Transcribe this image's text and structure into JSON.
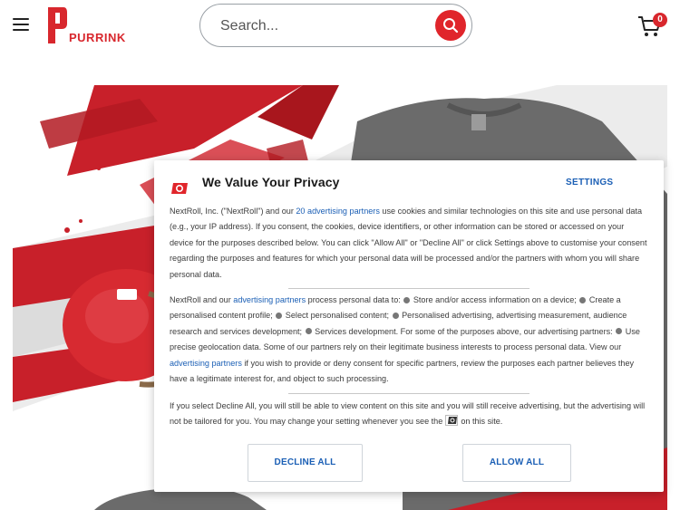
{
  "header": {
    "logo_text": "PURRINK",
    "search_placeholder": "Search...",
    "cart_count": "0"
  },
  "consent": {
    "title": "We Value Your Privacy",
    "settings_label": "SETTINGS",
    "p1_a": "NextRoll, Inc. (\"NextRoll\") and our ",
    "p1_link": "20 advertising partners",
    "p1_b": " use cookies and similar technologies on this site and use personal data (e.g., your IP address). If you consent, the cookies, device identifiers, or other information can be stored or accessed on your device for the purposes described below. You can click \"Allow All\" or \"Decline All\" or click Settings above to customise your consent regarding the purposes and features for which your personal data will be processed and/or the partners with whom you will share personal data.",
    "p2_a": "NextRoll and our ",
    "p2_link1": "advertising partners",
    "p2_b": " process personal data to: ",
    "p2_item1": " Store and/or access information on a device; ",
    "p2_item2": " Create a personalised content profile; ",
    "p2_item3": " Select personalised content; ",
    "p2_item4": " Personalised advertising, advertising measurement, audience research and services development; ",
    "p2_item5": " Services development. For some of the purposes above, our advertising partners: ",
    "p2_item6": " Use precise geolocation data. Some of our partners rely on their legitimate business interests to process personal data. View our ",
    "p2_link2": "advertising partners",
    "p2_c": " if you wish to provide or deny consent for specific partners, review the purposes each partner believes they have a legitimate interest for, and object to such processing.",
    "p3_a": "If you select Decline All, you will still be able to view content on this site and you will still receive advertising, but the advertising will not be tailored for you. You may change your setting whenever you see the",
    "p3_b": "on this site.",
    "decline_label": "DECLINE ALL",
    "allow_label": "ALLOW ALL"
  },
  "colors": {
    "brand_red": "#d8272d",
    "link_blue": "#1b5fb5"
  },
  "icons": [
    "menu-icon",
    "search-icon",
    "cart-icon",
    "nextroll-logo-icon"
  ]
}
